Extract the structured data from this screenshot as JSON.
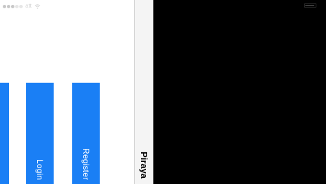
{
  "status_bar": {
    "carrier": "att",
    "signal_bars_filled": 3,
    "signal_bars_total": 5,
    "wifi_icon": "wifi-icon",
    "battery_level": 0.9
  },
  "buttons": {
    "login_label": "Login",
    "register_label": "Register"
  },
  "nav_bar": {
    "title": "Piraya"
  },
  "colors": {
    "button_blue": "#1a7ff5",
    "background": "#ffffff",
    "nav_background": "#f4f4f4",
    "offscreen": "#000000"
  }
}
